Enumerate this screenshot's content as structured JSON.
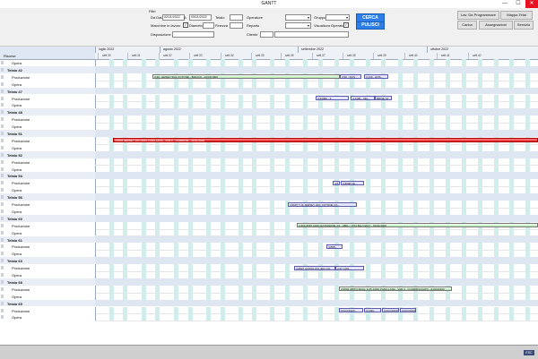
{
  "window": {
    "title": "GANTT",
    "minimize": "—",
    "maximize": "☐",
    "close": "✕"
  },
  "filters": {
    "heading": "Filtri",
    "da_data_label": "Da Data",
    "da_data_value": "02/11/2022",
    "a_label": "A",
    "a_value": "05/11/2022",
    "telaio_label": "Telaio",
    "telaio_value": "",
    "operatore_label": "Operatore",
    "operatore_value": "",
    "gruppo_label": "Gruppo",
    "gruppo_value": "",
    "macchine_label": "Macchine in lavoro",
    "macchine_checked": "✓",
    "diametro_label": "Diametro",
    "diametro_value": "",
    "finezza_label": "Finezza",
    "finezza_value": "",
    "reparto_label": "Reparto",
    "reparto_value": "",
    "visualizza_label": "Visualizza Operatori",
    "visualizza_checked": "✓",
    "disposizione_label": "Disposizione",
    "disposizione_value": "",
    "cliente_label": "Cliente",
    "cliente_value": "",
    "cerca": "CERCA",
    "pulisci": "PULISCI"
  },
  "actions": {
    "lav_programmare": "Lav. Da Programmare",
    "mappa_telai": "Mappa Telai",
    "carica": "Carica",
    "assegnazioni": "Assegnazioni",
    "servizio": "Servizio"
  },
  "gantt": {
    "resource_header": "Risorse",
    "months": [
      {
        "label": "luglio 2022"
      },
      {
        "label": "agosto 2022"
      },
      {
        "label": "settembre 2022"
      },
      {
        "label": "ottobre 2022"
      }
    ],
    "weeks": [
      "sett.30",
      "sett.31",
      "sett.32",
      "sett.33",
      "sett.34",
      "sett.35",
      "sett.36",
      "sett.37",
      "sett.38",
      "sett.39",
      "sett.40",
      "sett.41",
      "sett.42"
    ],
    "rows": [
      {
        "type": "sub",
        "label": "Opera"
      },
      {
        "type": "hdr",
        "label": "Telaio 42"
      },
      {
        "type": "sub",
        "label": "Produzione"
      },
      {
        "type": "sub",
        "label": "Opera"
      },
      {
        "type": "hdr",
        "label": "Telaio 47"
      },
      {
        "type": "sub",
        "label": "Produzione"
      },
      {
        "type": "sub",
        "label": "Opera"
      },
      {
        "type": "hdr",
        "label": "Telaio 48"
      },
      {
        "type": "sub",
        "label": "Produzione"
      },
      {
        "type": "sub",
        "label": "Opera"
      },
      {
        "type": "hdr",
        "label": "Telaio 51"
      },
      {
        "type": "sub",
        "label": "Produzione"
      },
      {
        "type": "sub",
        "label": "Opera"
      },
      {
        "type": "hdr",
        "label": "Telaio 52"
      },
      {
        "type": "sub",
        "label": "Produzione"
      },
      {
        "type": "sub",
        "label": "Opera"
      },
      {
        "type": "hdr",
        "label": "Telaio 54"
      },
      {
        "type": "sub",
        "label": "Produzione"
      },
      {
        "type": "sub",
        "label": "Opera"
      },
      {
        "type": "hdr",
        "label": "Telaio 56"
      },
      {
        "type": "sub",
        "label": "Produzione"
      },
      {
        "type": "sub",
        "label": "Opera"
      },
      {
        "type": "hdr",
        "label": "Telaio 60"
      },
      {
        "type": "sub",
        "label": "Produzione"
      },
      {
        "type": "sub",
        "label": "Opera"
      },
      {
        "type": "hdr",
        "label": "Telaio 61"
      },
      {
        "type": "sub",
        "label": "Produzione"
      },
      {
        "type": "sub",
        "label": "Opera"
      },
      {
        "type": "hdr",
        "label": "Telaio 63"
      },
      {
        "type": "sub",
        "label": "Produzione"
      },
      {
        "type": "sub",
        "label": "Opera"
      },
      {
        "type": "hdr",
        "label": "Telaio 68"
      },
      {
        "type": "sub",
        "label": "Produzione"
      },
      {
        "type": "sub",
        "label": "Opera"
      },
      {
        "type": "hdr",
        "label": "Telaio 69"
      },
      {
        "type": "sub",
        "label": "Produzione"
      },
      {
        "type": "sub",
        "label": "Opera"
      }
    ],
    "bars": [
      {
        "row": 2,
        "color": "green",
        "text": "4,90 - ERSEY 50/2 COTONE - BIANCO - 01/01/1900"
      },
      {
        "row": 2,
        "color": "purple",
        "text": "4,90 - AVIS..."
      },
      {
        "row": 2,
        "color": "purple",
        "text": "4,130 - AVIS..."
      },
      {
        "row": 5,
        "color": "purple",
        "text": "4,5438A - 3..."
      },
      {
        "row": 5,
        "color": "purple",
        "text": "4,1405 - VEL..."
      },
      {
        "row": 5,
        "color": "purple",
        "text": "BRISE 16..."
      },
      {
        "row": 11,
        "color": "red",
        "text": "4,6678 JERSEY 100 100% PURA LANA - VAR.K - CARBONE - 01/01/1900"
      },
      {
        "row": 17,
        "color": "purple",
        "text": "4,8..."
      },
      {
        "row": 17,
        "color": "purple",
        "text": "4,6838 FE..."
      },
      {
        "row": 20,
        "color": "purple",
        "text": "4,5697 T.JA JERSEY 40/1 COTONE GS..."
      },
      {
        "row": 23,
        "color": "green",
        "text": "4,369-3587 100% EXTRAFINE 4/1 - 0801 / 7074 BLU NAVY - 01/01/1900"
      },
      {
        "row": 26,
        "color": "purple",
        "text": "4,898..."
      },
      {
        "row": 29,
        "color": "purple",
        "text": "4,6837 COSTA 2X1 40/1 CO..."
      },
      {
        "row": 29,
        "color": "purple",
        "text": "4,37 COS..."
      },
      {
        "row": 32,
        "color": "green",
        "text": "4,9502 ABITO MAGL 1/15 100% PURA LANA - VAR.3 - CUORBOCCATO - 01/01/1900"
      },
      {
        "row": 35,
        "color": "purple",
        "text": "C(GO)1920..."
      },
      {
        "row": 35,
        "color": "purple",
        "text": "C1030..."
      },
      {
        "row": 35,
        "color": "purple",
        "text": "C(GO)1930..."
      },
      {
        "row": 35,
        "color": "purple",
        "text": "C(GO)1930..."
      }
    ]
  },
  "status": {
    "esc": "ESC"
  }
}
